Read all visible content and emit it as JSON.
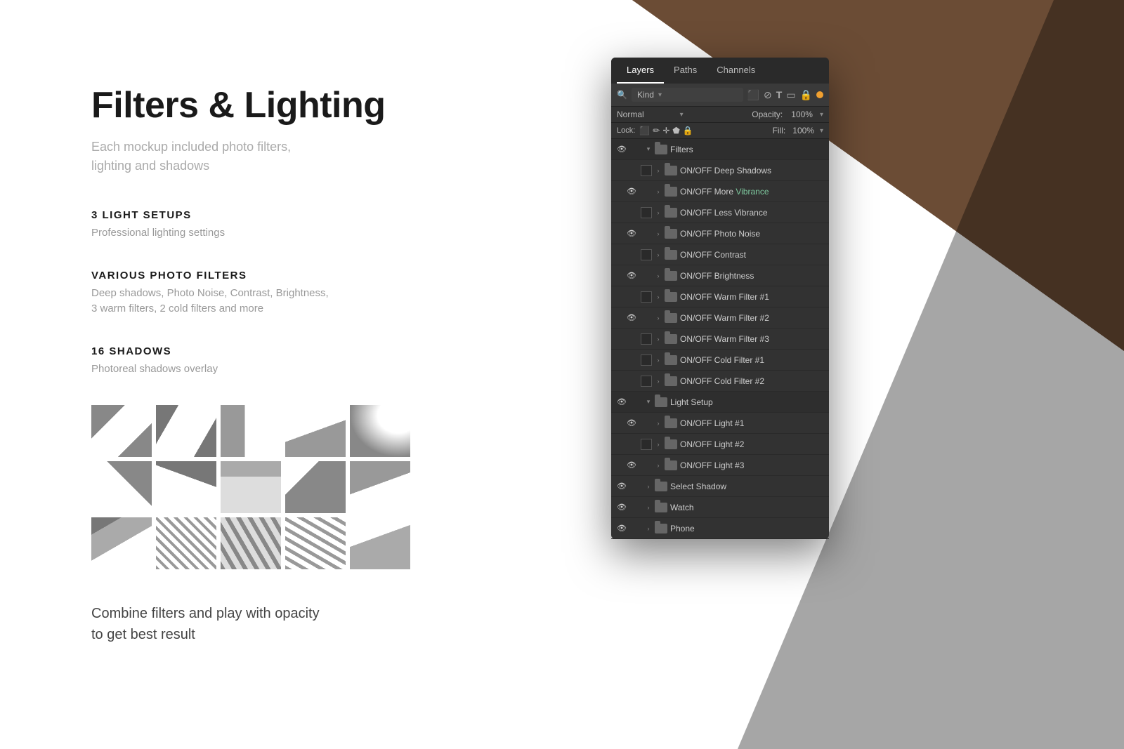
{
  "background": {
    "triangle_color": "#6b4c35"
  },
  "left_content": {
    "title": "Filters & Lighting",
    "subtitle": "Each mockup included photo filters,\nlighting and shadows",
    "sections": [
      {
        "heading": "3 LIGHT SETUPS",
        "description": "Professional lighting settings"
      },
      {
        "heading": "VARIOUS PHOTO FILTERS",
        "description": "Deep shadows, Photo Noise, Contrast, Brightness,\n3 warm filters, 2 cold filters and more"
      },
      {
        "heading": "16 SHADOWS",
        "description": "Photoreal shadows overlay"
      }
    ],
    "bottom_text": "Combine filters and play with opacity\nto get best result"
  },
  "ps_panel": {
    "tabs": [
      "Layers",
      "Paths",
      "Channels"
    ],
    "active_tab": "Layers",
    "kind_label": "Kind",
    "normal_label": "Normal",
    "opacity_label": "Opacity:",
    "lock_label": "Lock:",
    "fill_label": "Fill:",
    "layers": [
      {
        "visible": true,
        "expanded": true,
        "indent": 0,
        "type": "group",
        "name": "Filters",
        "checkbox": false
      },
      {
        "visible": false,
        "expanded": false,
        "indent": 1,
        "type": "folder",
        "name": "ON/OFF Deep Shadows",
        "checkbox": true
      },
      {
        "visible": true,
        "expanded": false,
        "indent": 1,
        "type": "folder",
        "name": "ON/OFF More Vibrance",
        "checkbox": false,
        "nameClass": "vibrance"
      },
      {
        "visible": false,
        "expanded": false,
        "indent": 1,
        "type": "folder",
        "name": "ON/OFF Less Vibrance",
        "checkbox": true
      },
      {
        "visible": true,
        "expanded": false,
        "indent": 1,
        "type": "folder",
        "name": "ON/OFF Photo Noise",
        "checkbox": false
      },
      {
        "visible": false,
        "expanded": false,
        "indent": 1,
        "type": "folder",
        "name": "ON/OFF Contrast",
        "checkbox": true
      },
      {
        "visible": true,
        "expanded": false,
        "indent": 1,
        "type": "folder",
        "name": "ON/OFF Brightness",
        "checkbox": false
      },
      {
        "visible": false,
        "expanded": false,
        "indent": 1,
        "type": "folder",
        "name": "ON/OFF Warm Filter #1",
        "checkbox": true
      },
      {
        "visible": true,
        "expanded": false,
        "indent": 1,
        "type": "folder",
        "name": "ON/OFF Warm Filter #2",
        "checkbox": false
      },
      {
        "visible": false,
        "expanded": false,
        "indent": 1,
        "type": "folder",
        "name": "ON/OFF Warm Filter #3",
        "checkbox": true
      },
      {
        "visible": false,
        "expanded": false,
        "indent": 1,
        "type": "folder",
        "name": "ON/OFF Cold Filter #1",
        "checkbox": true
      },
      {
        "visible": false,
        "expanded": false,
        "indent": 1,
        "type": "folder",
        "name": "ON/OFF Cold Filter #2",
        "checkbox": true
      },
      {
        "visible": true,
        "expanded": true,
        "indent": 0,
        "type": "group",
        "name": "Light Setup",
        "checkbox": false
      },
      {
        "visible": true,
        "expanded": false,
        "indent": 1,
        "type": "folder",
        "name": "ON/OFF Light #1",
        "checkbox": false
      },
      {
        "visible": false,
        "expanded": false,
        "indent": 1,
        "type": "folder",
        "name": "ON/OFF Light #2",
        "checkbox": true
      },
      {
        "visible": true,
        "expanded": false,
        "indent": 1,
        "type": "folder",
        "name": "ON/OFF Light #3",
        "checkbox": false
      },
      {
        "visible": true,
        "expanded": false,
        "indent": 0,
        "type": "group",
        "name": "Select Shadow",
        "checkbox": false
      },
      {
        "visible": true,
        "expanded": false,
        "indent": 0,
        "type": "folder-sub",
        "name": "Watch",
        "checkbox": false
      },
      {
        "visible": true,
        "expanded": false,
        "indent": 0,
        "type": "folder-sub",
        "name": "Phone",
        "checkbox": false
      }
    ]
  }
}
